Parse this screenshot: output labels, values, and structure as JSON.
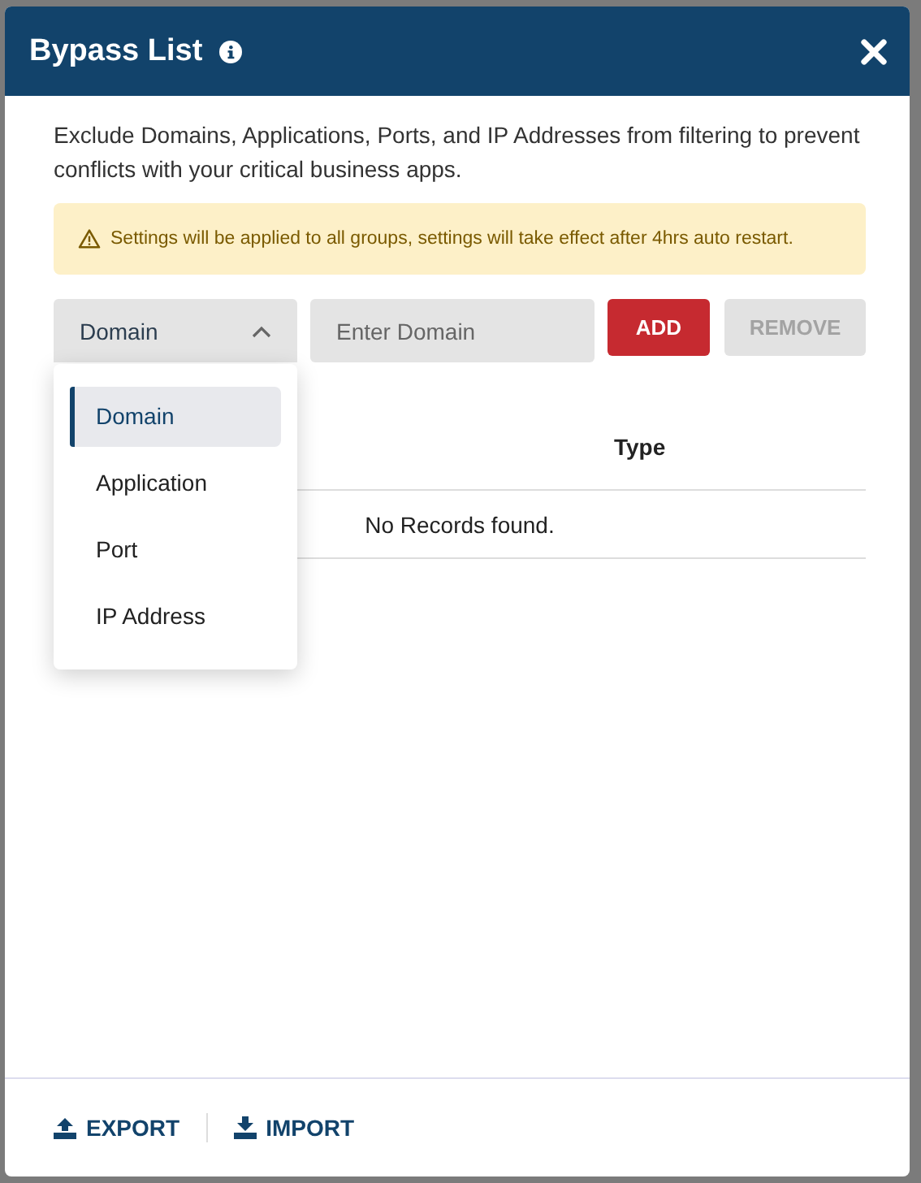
{
  "dialog": {
    "title": "Bypass List",
    "description": "Exclude Domains, Applications, Ports, and IP Addresses from filtering to prevent conflicts with your critical business apps.",
    "warning": "Settings will be applied to all groups, settings will take effect after 4hrs auto restart.",
    "type_select": {
      "value": "Domain",
      "expanded": true,
      "options": [
        {
          "label": "Domain",
          "selected": true
        },
        {
          "label": "Application",
          "selected": false
        },
        {
          "label": "Port",
          "selected": false
        },
        {
          "label": "IP Address",
          "selected": false
        }
      ]
    },
    "entry_field": {
      "placeholder": "Enter Domain"
    },
    "buttons": [
      {
        "label": "ADD",
        "kind": "primary",
        "disabled": false
      },
      {
        "label": "REMOVE",
        "kind": "secondary",
        "disabled": true
      }
    ],
    "table": {
      "columns": [
        "Type"
      ],
      "empty_message": "No Records found."
    },
    "footer_actions": [
      {
        "label": "EXPORT",
        "kind": "export"
      },
      {
        "label": "IMPORT",
        "kind": "import"
      }
    ]
  }
}
